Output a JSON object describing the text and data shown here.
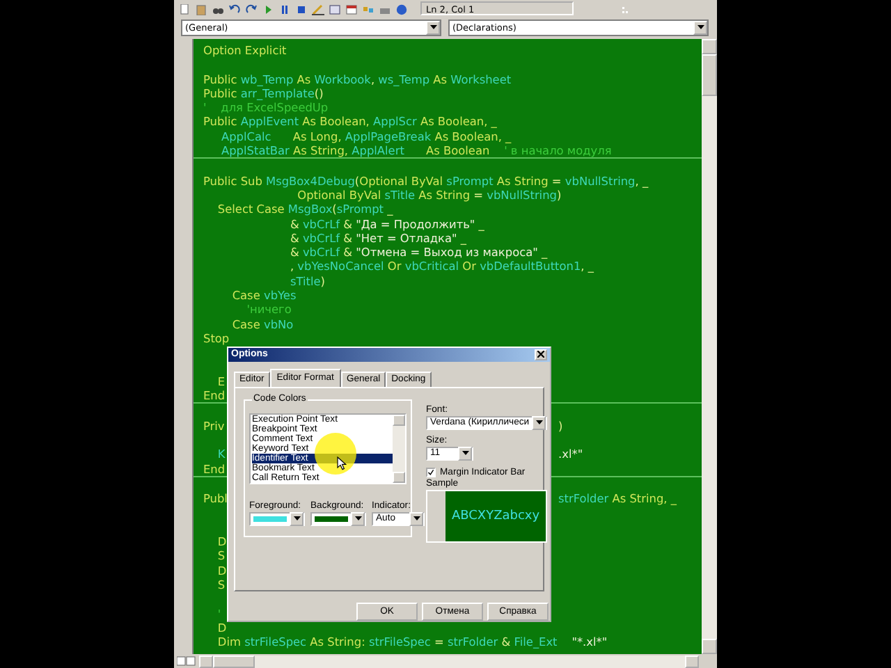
{
  "toolbar": {
    "position": "Ln 2, Col 1"
  },
  "object_combo": {
    "value": "(General)"
  },
  "procedure_combo": {
    "value": "(Declarations)"
  },
  "code_lines": [
    {
      "kind": "code",
      "segments": [
        {
          "text": "Option Explicit",
          "kind": "kw"
        }
      ]
    },
    {
      "kind": "blank"
    },
    {
      "kind": "code",
      "segments": [
        {
          "text": "Public ",
          "kind": "kw"
        },
        {
          "text": "wb_Temp",
          "kind": "id"
        },
        {
          "text": " As ",
          "kind": "kw"
        },
        {
          "text": "Workbook",
          "kind": "id"
        },
        {
          "text": ", ",
          "kind": "op"
        },
        {
          "text": "ws_Temp",
          "kind": "id"
        },
        {
          "text": " As ",
          "kind": "kw"
        },
        {
          "text": "Worksheet",
          "kind": "id"
        }
      ]
    },
    {
      "kind": "code",
      "segments": [
        {
          "text": "Public ",
          "kind": "kw"
        },
        {
          "text": "arr_Template",
          "kind": "id"
        },
        {
          "text": "()",
          "kind": "op"
        }
      ]
    },
    {
      "kind": "code",
      "segments": [
        {
          "text": "'    для ExcelSpeedUp",
          "kind": "cm"
        }
      ]
    },
    {
      "kind": "code",
      "segments": [
        {
          "text": "Public ",
          "kind": "kw"
        },
        {
          "text": "ApplEvent",
          "kind": "id"
        },
        {
          "text": " As Boolean, ",
          "kind": "kw"
        },
        {
          "text": "ApplScr",
          "kind": "id"
        },
        {
          "text": " As Boolean, _",
          "kind": "kw"
        }
      ]
    },
    {
      "kind": "code",
      "segments": [
        {
          "text": "     ApplCalc",
          "kind": "id"
        },
        {
          "text": "      As Long, ",
          "kind": "kw"
        },
        {
          "text": "ApplPageBreak",
          "kind": "id"
        },
        {
          "text": " As Boolean, _",
          "kind": "kw"
        }
      ]
    },
    {
      "kind": "code",
      "segments": [
        {
          "text": "     ApplStatBar",
          "kind": "id"
        },
        {
          "text": " As String, ",
          "kind": "kw"
        },
        {
          "text": "ApplAlert",
          "kind": "id"
        },
        {
          "text": "      As Boolean",
          "kind": "kw"
        },
        {
          "text": "    ' в начало модуля",
          "kind": "cm"
        }
      ]
    },
    {
      "kind": "separator"
    },
    {
      "kind": "blank"
    },
    {
      "kind": "code",
      "segments": [
        {
          "text": "Public Sub ",
          "kind": "kw"
        },
        {
          "text": "MsgBox4Debug",
          "kind": "id"
        },
        {
          "text": "(",
          "kind": "op"
        },
        {
          "text": "Optional ByVal ",
          "kind": "kw"
        },
        {
          "text": "sPrompt",
          "kind": "id"
        },
        {
          "text": " As String",
          "kind": "kw"
        },
        {
          "text": " = ",
          "kind": "op"
        },
        {
          "text": "vbNullString",
          "kind": "id"
        },
        {
          "text": ", _",
          "kind": "op"
        }
      ]
    },
    {
      "kind": "code",
      "segments": [
        {
          "text": "                          Optional ByVal ",
          "kind": "kw"
        },
        {
          "text": "sTitle",
          "kind": "id"
        },
        {
          "text": " As String",
          "kind": "kw"
        },
        {
          "text": " = ",
          "kind": "op"
        },
        {
          "text": "vbNullString",
          "kind": "id"
        },
        {
          "text": ")",
          "kind": "op"
        }
      ]
    },
    {
      "kind": "code",
      "segments": [
        {
          "text": "    Select Case ",
          "kind": "kw"
        },
        {
          "text": "MsgBox",
          "kind": "id"
        },
        {
          "text": "(",
          "kind": "op"
        },
        {
          "text": "sPrompt",
          "kind": "id"
        },
        {
          "text": " _",
          "kind": "op"
        }
      ]
    },
    {
      "kind": "code",
      "segments": [
        {
          "text": "                        & ",
          "kind": "op"
        },
        {
          "text": "vbCrLf",
          "kind": "id"
        },
        {
          "text": " & ",
          "kind": "op"
        },
        {
          "text": "\"Да = Продолжить\"",
          "kind": "str"
        },
        {
          "text": " _",
          "kind": "op"
        }
      ]
    },
    {
      "kind": "code",
      "segments": [
        {
          "text": "                        & ",
          "kind": "op"
        },
        {
          "text": "vbCrLf",
          "kind": "id"
        },
        {
          "text": " & ",
          "kind": "op"
        },
        {
          "text": "\"Нет = Отладка\"",
          "kind": "str"
        },
        {
          "text": " _",
          "kind": "op"
        }
      ]
    },
    {
      "kind": "code",
      "segments": [
        {
          "text": "                        & ",
          "kind": "op"
        },
        {
          "text": "vbCrLf",
          "kind": "id"
        },
        {
          "text": " & ",
          "kind": "op"
        },
        {
          "text": "\"Отмена = Выход из макроса\"",
          "kind": "str"
        },
        {
          "text": " _",
          "kind": "op"
        }
      ]
    },
    {
      "kind": "code",
      "segments": [
        {
          "text": "                        , ",
          "kind": "op"
        },
        {
          "text": "vbYesNoCancel",
          "kind": "id"
        },
        {
          "text": " Or ",
          "kind": "kw"
        },
        {
          "text": "vbCritical",
          "kind": "id"
        },
        {
          "text": " Or ",
          "kind": "kw"
        },
        {
          "text": "vbDefaultButton1",
          "kind": "id"
        },
        {
          "text": ", _",
          "kind": "op"
        }
      ]
    },
    {
      "kind": "code",
      "segments": [
        {
          "text": "                        sTitle",
          "kind": "id"
        },
        {
          "text": ")",
          "kind": "op"
        }
      ]
    },
    {
      "kind": "code",
      "segments": [
        {
          "text": "        Case ",
          "kind": "kw"
        },
        {
          "text": "vbYes",
          "kind": "id"
        }
      ]
    },
    {
      "kind": "code",
      "segments": [
        {
          "text": "            'ничего",
          "kind": "cm"
        }
      ]
    },
    {
      "kind": "code",
      "segments": [
        {
          "text": "        Case ",
          "kind": "kw"
        },
        {
          "text": "vbNo",
          "kind": "id"
        }
      ]
    },
    {
      "kind": "code",
      "segments": [
        {
          "text": "Stop",
          "kind": "kw"
        }
      ]
    },
    {
      "kind": "blank"
    },
    {
      "kind": "blank"
    },
    {
      "kind": "code",
      "segments": [
        {
          "text": "    E",
          "kind": "kw"
        }
      ]
    },
    {
      "kind": "code",
      "segments": [
        {
          "text": "End",
          "kind": "kw"
        }
      ]
    },
    {
      "kind": "separator"
    },
    {
      "kind": "blank"
    },
    {
      "kind": "code",
      "segments": [
        {
          "text": "Priv",
          "kind": "kw"
        }
      ],
      "right": [
        {
          "text": ")",
          "kind": "op"
        }
      ]
    },
    {
      "kind": "blank"
    },
    {
      "kind": "code",
      "segments": [
        {
          "text": "    K",
          "kind": "id"
        }
      ],
      "right": [
        {
          "text": ".xl*\"",
          "kind": "str"
        }
      ]
    },
    {
      "kind": "code",
      "segments": [
        {
          "text": "End",
          "kind": "kw"
        }
      ]
    },
    {
      "kind": "separator"
    },
    {
      "kind": "blank"
    },
    {
      "kind": "code",
      "segments": [
        {
          "text": "Publ",
          "kind": "kw"
        }
      ],
      "right": [
        {
          "text": "strFolder",
          "kind": "id"
        },
        {
          "text": " As String, _",
          "kind": "kw"
        }
      ]
    },
    {
      "kind": "blank"
    },
    {
      "kind": "blank"
    },
    {
      "kind": "code",
      "segments": [
        {
          "text": "    D",
          "kind": "kw"
        }
      ]
    },
    {
      "kind": "code",
      "segments": [
        {
          "text": "    S",
          "kind": "kw"
        }
      ]
    },
    {
      "kind": "code",
      "segments": [
        {
          "text": "    D",
          "kind": "kw"
        }
      ]
    },
    {
      "kind": "code",
      "segments": [
        {
          "text": "    S",
          "kind": "kw"
        }
      ]
    },
    {
      "kind": "blank"
    },
    {
      "kind": "code",
      "segments": [
        {
          "text": "    '",
          "kind": "cm"
        }
      ]
    },
    {
      "kind": "code",
      "segments": [
        {
          "text": "    D",
          "kind": "kw"
        }
      ]
    },
    {
      "kind": "code",
      "segments": [
        {
          "text": "    Dim ",
          "kind": "kw"
        },
        {
          "text": "strFileSpec",
          "kind": "id"
        },
        {
          "text": " As String: ",
          "kind": "kw"
        },
        {
          "text": "strFileSpec",
          "kind": "id"
        },
        {
          "text": " = ",
          "kind": "op"
        },
        {
          "text": "strFolder",
          "kind": "id"
        },
        {
          "text": " & ",
          "kind": "op"
        },
        {
          "text": "File_Ext",
          "kind": "id"
        },
        {
          "text": "    \"*.xl*\"",
          "kind": "str"
        }
      ]
    }
  ],
  "dialog": {
    "title": "Options",
    "tabs": [
      {
        "label": "Editor",
        "selected": false
      },
      {
        "label": "Editor Format",
        "selected": true
      },
      {
        "label": "General",
        "selected": false
      },
      {
        "label": "Docking",
        "selected": false
      }
    ],
    "code_colors": {
      "label": "Code Colors",
      "items": [
        {
          "label": "Execution Point Text",
          "selected": false
        },
        {
          "label": "Breakpoint Text",
          "selected": false
        },
        {
          "label": "Comment Text",
          "selected": false
        },
        {
          "label": "Keyword Text",
          "selected": false
        },
        {
          "label": "Identifier Text",
          "selected": true
        },
        {
          "label": "Bookmark Text",
          "selected": false
        },
        {
          "label": "Call Return Text",
          "selected": false
        }
      ]
    },
    "foreground": {
      "label": "Foreground:",
      "color": "#40e0e0"
    },
    "background": {
      "label": "Background:",
      "color": "#006400"
    },
    "indicator": {
      "label": "Indicator:",
      "value": "Auto"
    },
    "font": {
      "label": "Font:",
      "value": "Verdana (Кирилличеси"
    },
    "size": {
      "label": "Size:",
      "value": "11"
    },
    "margin_indicator_bar": {
      "label": "Margin Indicator Bar",
      "checked": true
    },
    "sample": {
      "label": "Sample",
      "text": "ABCXYZabcxy"
    },
    "buttons": [
      "OK",
      "Отмена",
      "Справка"
    ]
  }
}
